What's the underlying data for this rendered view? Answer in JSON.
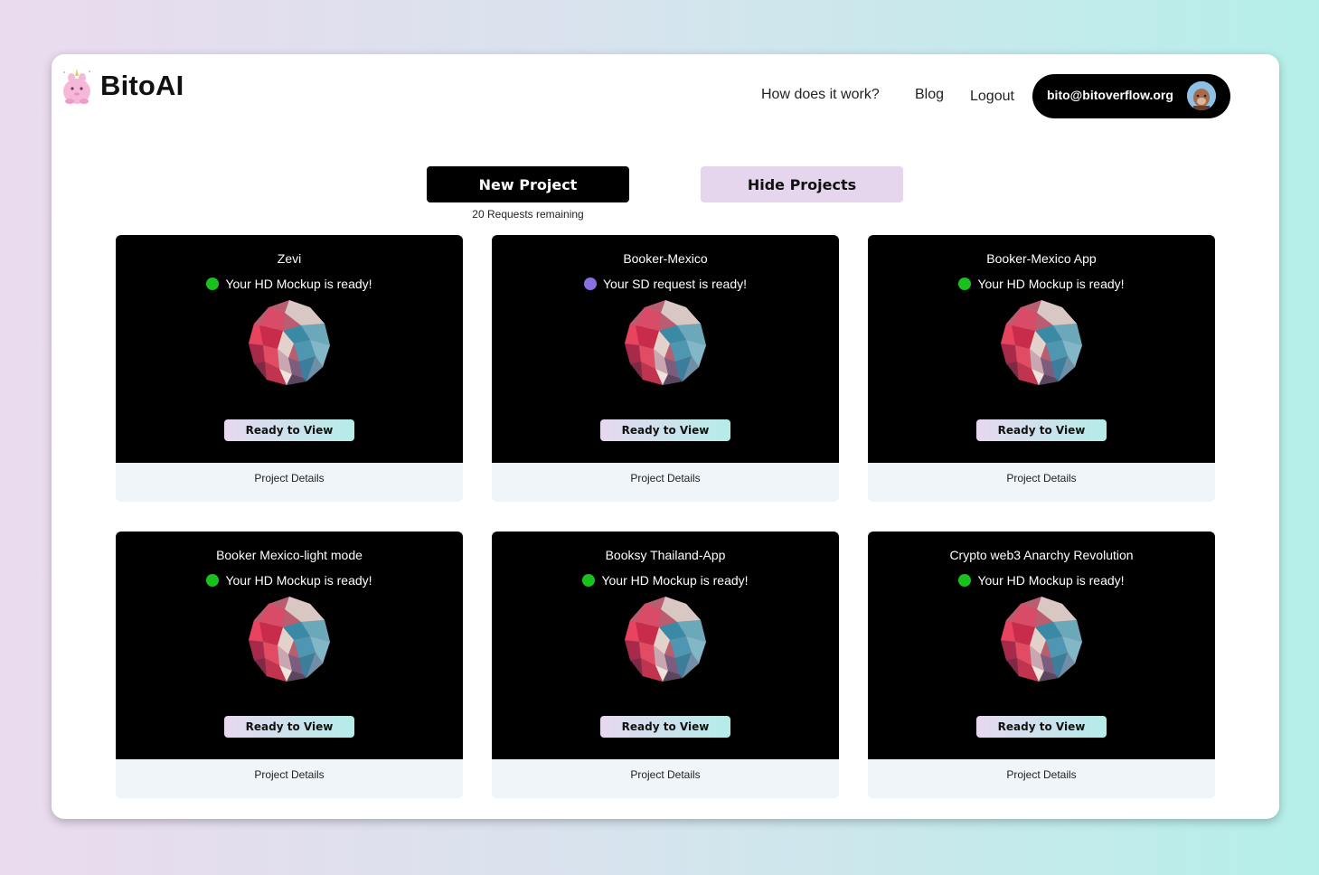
{
  "app": {
    "name": "BitoAI"
  },
  "nav": {
    "how_it_works": "How does it work?",
    "blog": "Blog",
    "logout": "Logout"
  },
  "user": {
    "email": "bito@bitoverflow.org"
  },
  "actions": {
    "new_project": "New Project",
    "requests_remaining": "20 Requests remaining",
    "hide_projects": "Hide Projects"
  },
  "colors": {
    "status_ready_hd": "#19c11c",
    "status_ready_sd": "#8a6fe0"
  },
  "projects": [
    {
      "title": "Zevi",
      "status": "Your HD Mockup is ready!",
      "status_type": "hd",
      "view_label": "Ready to View",
      "details_label": "Project Details"
    },
    {
      "title": "Booker-Mexico",
      "status": "Your SD request is ready!",
      "status_type": "sd",
      "view_label": "Ready to View",
      "details_label": "Project Details"
    },
    {
      "title": "Booker-Mexico App",
      "status": "Your HD Mockup is ready!",
      "status_type": "hd",
      "view_label": "Ready to View",
      "details_label": "Project Details"
    },
    {
      "title": "Booker Mexico-light mode",
      "status": "Your HD Mockup is ready!",
      "status_type": "hd",
      "view_label": "Ready to View",
      "details_label": "Project Details"
    },
    {
      "title": "Booksy Thailand-App",
      "status": "Your HD Mockup is ready!",
      "status_type": "hd",
      "view_label": "Ready to View",
      "details_label": "Project Details"
    },
    {
      "title": "Crypto web3 Anarchy Revolution",
      "status": "Your HD Mockup is ready!",
      "status_type": "hd",
      "view_label": "Ready to View",
      "details_label": "Project Details"
    }
  ]
}
